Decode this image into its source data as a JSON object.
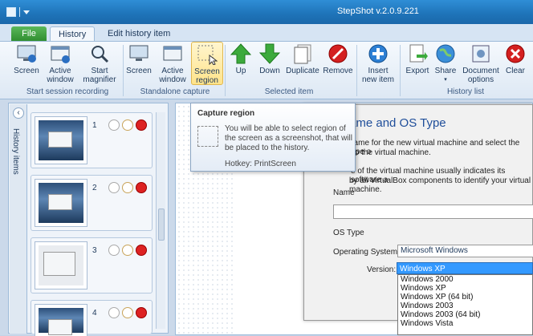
{
  "app": {
    "title": "StepShot v.2.0.9.221"
  },
  "tabs": {
    "file": "File",
    "history": "History",
    "edit": "Edit history item"
  },
  "ribbon": {
    "session": {
      "label": "Start session recording",
      "buttons": [
        "Screen",
        "Active window",
        "Start magnifier"
      ]
    },
    "standalone": {
      "label": "Standalone capture",
      "buttons": [
        "Screen",
        "Active window",
        "Screen region"
      ]
    },
    "selected": {
      "label": "Selected item",
      "buttons": [
        "Up",
        "Down",
        "Duplicate",
        "Remove"
      ]
    },
    "history": {
      "label": "History list",
      "buttons": [
        "Insert new item",
        "Export",
        "Share",
        "Document options",
        "Clear"
      ]
    }
  },
  "history_panel": {
    "side_label": "History items",
    "items": [
      {
        "num": "1"
      },
      {
        "num": "2"
      },
      {
        "num": "3"
      },
      {
        "num": "4"
      }
    ]
  },
  "tooltip": {
    "title": "Capture region",
    "desc": "You will be able to select region of the screen as a screenshot, that will be placed to the history.",
    "hotkey": "Hotkey: PrintScreen"
  },
  "screenshot_content": {
    "heading": "ame and OS Type",
    "line1": "name for the new virtual machine and select the type o",
    "line2": "to the virtual machine.",
    "line3": "e of the virtual machine usually indicates its software a",
    "line4": "by all VirtualBox components to identify your virtual machine.",
    "name_label": "Name",
    "os_type_label": "OS Type",
    "os_label": "Operating System:",
    "os_value": "Microsoft Windows",
    "version_label": "Version:",
    "version_value": "Windows XP",
    "version_options": [
      "Windows 2000",
      "Windows XP",
      "Windows XP (64 bit)",
      "Windows 2003",
      "Windows 2003 (64 bit)",
      "Windows Vista"
    ]
  },
  "colors": {
    "titlebar": "#1e73b8",
    "file_tab": "#2f8c2f",
    "selection": "#3399ff"
  }
}
